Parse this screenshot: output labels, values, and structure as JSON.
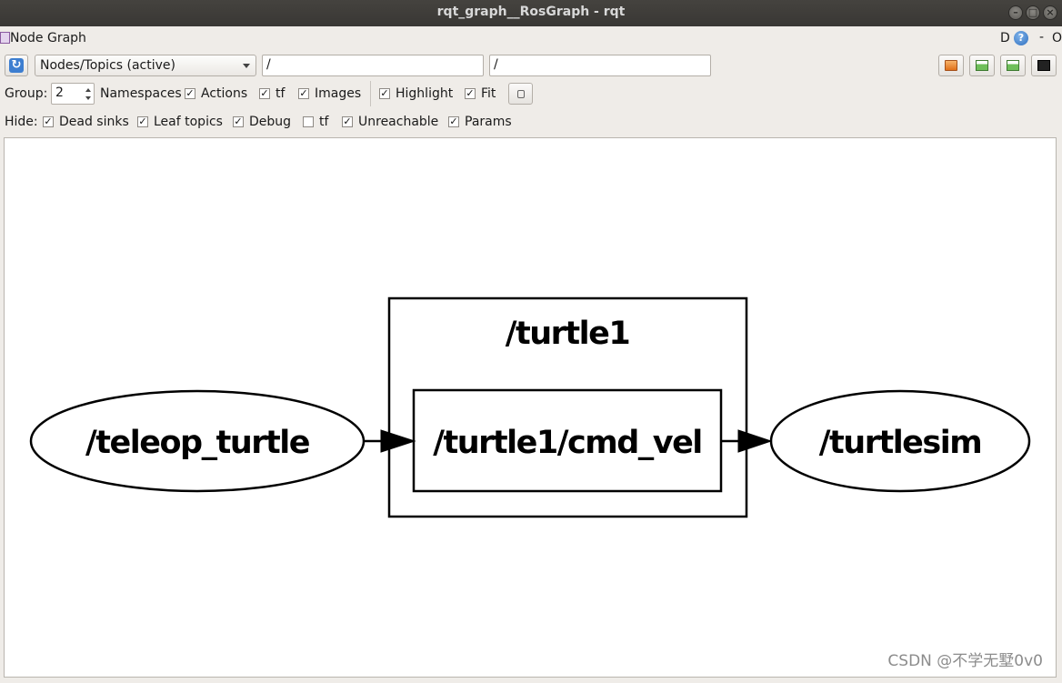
{
  "window": {
    "title": "rqt_graph__RosGraph - rqt"
  },
  "plugin_header": {
    "title": "Node Graph",
    "right_D": "D",
    "help": "?",
    "dash": "-",
    "o": "O"
  },
  "toolbar": {
    "view_mode": "Nodes/Topics (active)",
    "filter_include": "/",
    "filter_exclude": "/"
  },
  "options": {
    "group_label": "Group:",
    "group_value": "2",
    "namespaces": "Namespaces",
    "actions": "Actions",
    "tf": "tf",
    "images": "Images",
    "highlight": "Highlight",
    "fit": "Fit",
    "checks": {
      "actions": true,
      "tf": true,
      "images": true,
      "highlight": true,
      "fit": true
    }
  },
  "hide": {
    "label": "Hide:",
    "dead_sinks": "Dead sinks",
    "leaf_topics": "Leaf topics",
    "debug": "Debug",
    "tf": "tf",
    "unreachable": "Unreachable",
    "params": "Params",
    "checks": {
      "dead_sinks": true,
      "leaf_topics": true,
      "debug": true,
      "tf": false,
      "unreachable": true,
      "params": true
    }
  },
  "graph": {
    "namespace_box": "/turtle1",
    "node_left": "/teleop_turtle",
    "topic": "/turtle1/cmd_vel",
    "node_right": "/turtlesim"
  },
  "watermark": "CSDN @不学无墅0v0",
  "icons": {
    "refresh": "refresh-icon",
    "open": "open-folder-icon",
    "save_dot": "save-dot-icon",
    "save_image": "save-image-icon",
    "screenshot": "screenshot-icon",
    "help": "help-icon"
  }
}
